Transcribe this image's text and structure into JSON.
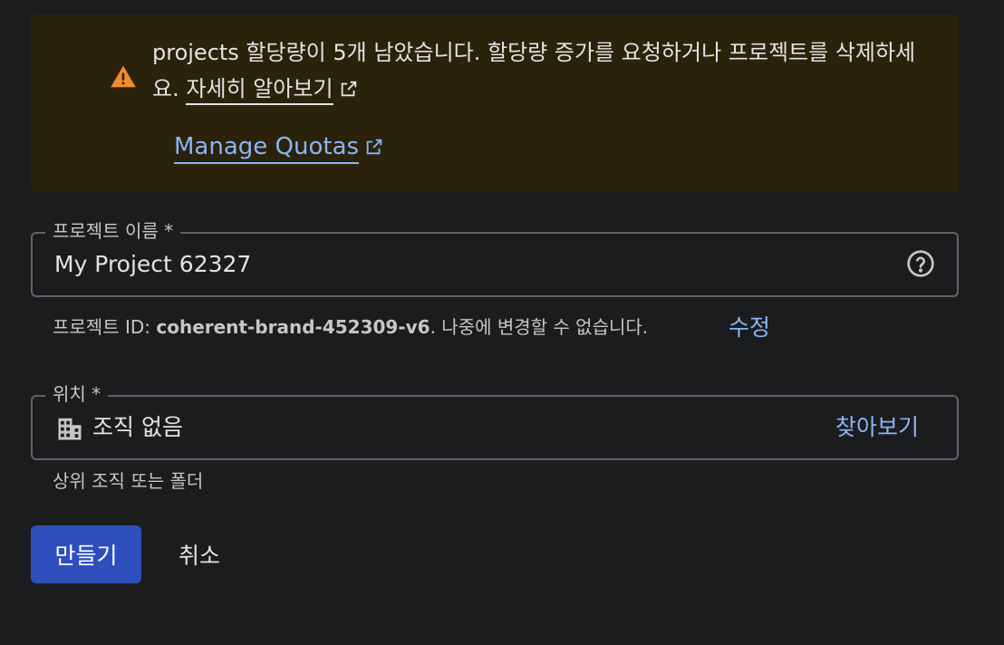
{
  "banner": {
    "message": "projects 할당량이 5개 남았습니다. 할당량 증가를 요청하거나 프로젝트를 삭제하세요.",
    "learn_more": "자세히 알아보기",
    "manage_quotas": "Manage Quotas",
    "icon": "warning-icon",
    "warning_color": "#f28b2c"
  },
  "project_name": {
    "label": "프로젝트 이름 *",
    "value": "My Project 62327",
    "icon": "help-icon"
  },
  "project_id": {
    "prefix": "프로젝트 ID:",
    "id": "coherent-brand-452309-v6",
    "suffix": ". 나중에 변경할 수 없습니다.",
    "edit_label": "수정"
  },
  "location": {
    "label": "위치 *",
    "value": "조직 없음",
    "icon": "organization-icon",
    "browse_label": "찾아보기",
    "hint": "상위 조직 또는 폴더"
  },
  "actions": {
    "create_label": "만들기",
    "cancel_label": "취소"
  },
  "colors": {
    "accent": "#8ab4f8",
    "primary_button": "#2f4ebd",
    "banner_bg": "#2b220c"
  }
}
